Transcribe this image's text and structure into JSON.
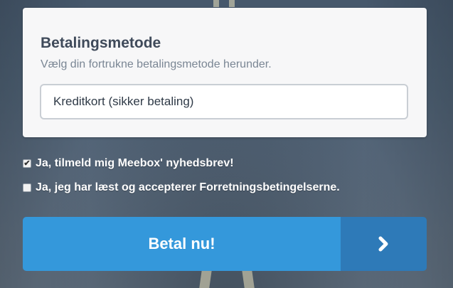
{
  "payment": {
    "title": "Betalingsmetode",
    "subtitle": "Vælg din fortrukne betalingsmetode herunder.",
    "selected_method": "Kreditkort (sikker betaling)"
  },
  "checkboxes": [
    {
      "label": "Ja, tilmeld mig Meebox' nyhedsbrev!",
      "checked": true
    },
    {
      "label": "Ja, jeg har læst og accepterer Forretningsbetingelserne.",
      "checked": false
    }
  ],
  "pay_button": {
    "label": "Betal nu!",
    "icon": "chevron-right-icon"
  },
  "colors": {
    "pay_button": "#3498db",
    "pay_arrow": "#2e7ab8"
  }
}
